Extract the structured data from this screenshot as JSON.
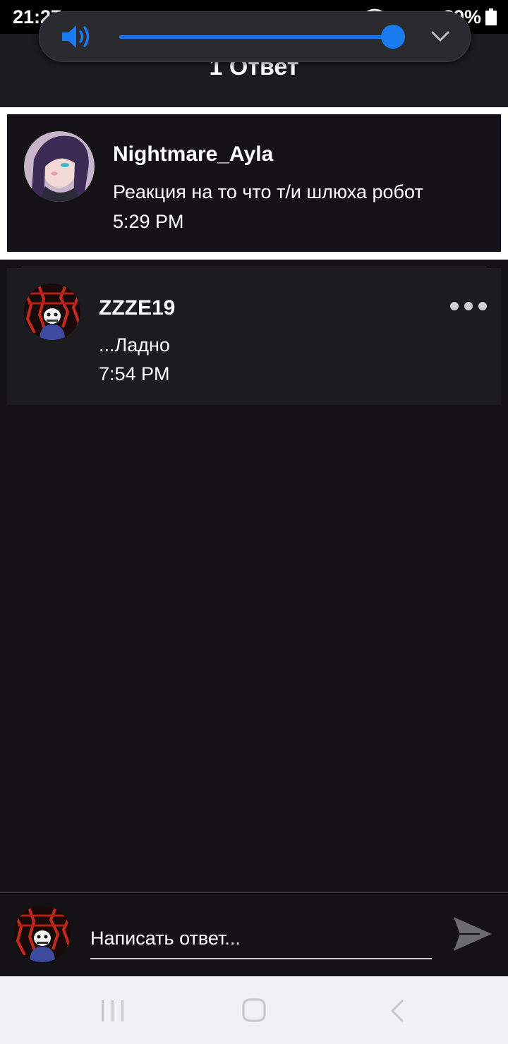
{
  "status_bar": {
    "time": "21:27",
    "battery": "89%"
  },
  "header": {
    "title": "1 Ответ"
  },
  "volume": {
    "level": 0.99,
    "accent_color": "#1a7cf0"
  },
  "original_post": {
    "username": "Nightmare_Ayla",
    "text": "Реакция на то что т/и шлюха робот",
    "time": "5:29 PM"
  },
  "reply": {
    "username": "ZZZE19",
    "text": "...Ладно",
    "time": "7:54 PM"
  },
  "compose": {
    "placeholder": "Написать ответ..."
  },
  "icons": {
    "speaker": "speaker-icon",
    "chevron": "chevron-down-icon",
    "more": "more-options-icon",
    "send": "send-icon",
    "recents": "recents-icon",
    "home": "home-icon",
    "back": "back-icon"
  }
}
